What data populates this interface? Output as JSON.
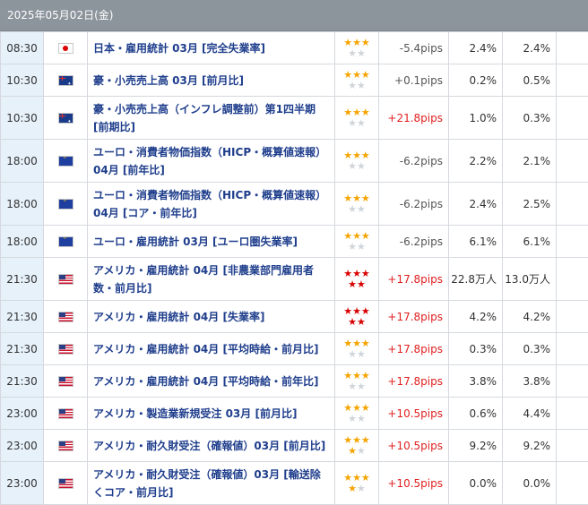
{
  "header": {
    "date": "2025年05月02日(金)"
  },
  "rows": [
    {
      "time": "08:30",
      "flag": "jp",
      "flag_icon": "japan-flag-icon",
      "title": "日本・雇用統計 03月 [完全失業率]",
      "stars": [
        3,
        0
      ],
      "star_color": "gold",
      "pips": "-5.4pips",
      "pips_sign": "neg",
      "actual": "2.4%",
      "forecast": "2.4%",
      "previous": "---",
      "h": 36
    },
    {
      "time": "10:30",
      "flag": "au",
      "flag_icon": "australia-flag-icon",
      "title": "豪・小売売上高 03月 [前月比]",
      "stars": [
        3,
        0
      ],
      "star_color": "gold",
      "pips": "+0.1pips",
      "pips_sign": "neg",
      "actual": "0.2%",
      "forecast": "0.5%",
      "previous": "---",
      "h": 36
    },
    {
      "time": "10:30",
      "flag": "au",
      "flag_icon": "australia-flag-icon",
      "title": "豪・小売売上高（インフレ調整前）第1四半期 [前期比]",
      "stars": [
        3,
        0
      ],
      "star_color": "gold",
      "pips": "+21.8pips",
      "pips_sign": "pos",
      "actual": "1.0%",
      "forecast": "0.3%",
      "previous": "---",
      "h": 48
    },
    {
      "time": "18:00",
      "flag": "eu",
      "flag_icon": "eu-flag-icon",
      "title": "ユーロ・消費者物価指数（HICP・概算値速報）04月 [前年比]",
      "stars": [
        3,
        0
      ],
      "star_color": "gold",
      "pips": "-6.2pips",
      "pips_sign": "neg",
      "actual": "2.2%",
      "forecast": "2.1%",
      "previous": "---",
      "h": 48
    },
    {
      "time": "18:00",
      "flag": "eu",
      "flag_icon": "eu-flag-icon",
      "title": "ユーロ・消費者物価指数（HICP・概算値速報）04月 [コア・前年比]",
      "stars": [
        3,
        0
      ],
      "star_color": "gold",
      "pips": "-6.2pips",
      "pips_sign": "neg",
      "actual": "2.4%",
      "forecast": "2.5%",
      "previous": "---",
      "h": 48
    },
    {
      "time": "18:00",
      "flag": "eu",
      "flag_icon": "eu-flag-icon",
      "title": "ユーロ・雇用統計 03月 [ユーロ圏失業率]",
      "stars": [
        3,
        0
      ],
      "star_color": "gold",
      "pips": "-6.2pips",
      "pips_sign": "neg",
      "actual": "6.1%",
      "forecast": "6.1%",
      "previous": "---",
      "h": 36
    },
    {
      "time": "21:30",
      "flag": "us",
      "flag_icon": "usa-flag-icon",
      "title": "アメリカ・雇用統計 04月 [非農業部門雇用者数・前月比]",
      "stars": [
        3,
        2
      ],
      "star_color": "red",
      "pips": "+17.8pips",
      "pips_sign": "pos",
      "actual": "22.8万人",
      "forecast": "13.0万人",
      "previous": "---",
      "h": 48
    },
    {
      "time": "21:30",
      "flag": "us",
      "flag_icon": "usa-flag-icon",
      "title": "アメリカ・雇用統計 04月 [失業率]",
      "stars": [
        3,
        2
      ],
      "star_color": "red",
      "pips": "+17.8pips",
      "pips_sign": "pos",
      "actual": "4.2%",
      "forecast": "4.2%",
      "previous": "---",
      "h": 36
    },
    {
      "time": "21:30",
      "flag": "us",
      "flag_icon": "usa-flag-icon",
      "title": "アメリカ・雇用統計 04月 [平均時給・前月比]",
      "stars": [
        3,
        0
      ],
      "star_color": "gold",
      "pips": "+17.8pips",
      "pips_sign": "pos",
      "actual": "0.3%",
      "forecast": "0.3%",
      "previous": "---",
      "h": 36
    },
    {
      "time": "21:30",
      "flag": "us",
      "flag_icon": "usa-flag-icon",
      "title": "アメリカ・雇用統計 04月 [平均時給・前年比]",
      "stars": [
        3,
        0
      ],
      "star_color": "gold",
      "pips": "+17.8pips",
      "pips_sign": "pos",
      "actual": "3.8%",
      "forecast": "3.8%",
      "previous": "---",
      "h": 36
    },
    {
      "time": "23:00",
      "flag": "us",
      "flag_icon": "usa-flag-icon",
      "title": "アメリカ・製造業新規受注 03月 [前月比]",
      "stars": [
        3,
        0
      ],
      "star_color": "gold",
      "pips": "+10.5pips",
      "pips_sign": "pos",
      "actual": "0.6%",
      "forecast": "4.4%",
      "previous": "---",
      "h": 36
    },
    {
      "time": "23:00",
      "flag": "us",
      "flag_icon": "usa-flag-icon",
      "title": "アメリカ・耐久財受注（確報値）03月 [前月比]",
      "stars": [
        3,
        1
      ],
      "star_color": "gold",
      "pips": "+10.5pips",
      "pips_sign": "pos",
      "actual": "9.2%",
      "forecast": "9.2%",
      "previous": "---",
      "h": 36
    },
    {
      "time": "23:00",
      "flag": "us",
      "flag_icon": "usa-flag-icon",
      "title": "アメリカ・耐久財受注（確報値）03月 [輸送除くコア・前月比]",
      "stars": [
        3,
        1
      ],
      "star_color": "gold",
      "pips": "+10.5pips",
      "pips_sign": "pos",
      "actual": "0.0%",
      "forecast": "0.0%",
      "previous": "---",
      "h": 48
    }
  ]
}
